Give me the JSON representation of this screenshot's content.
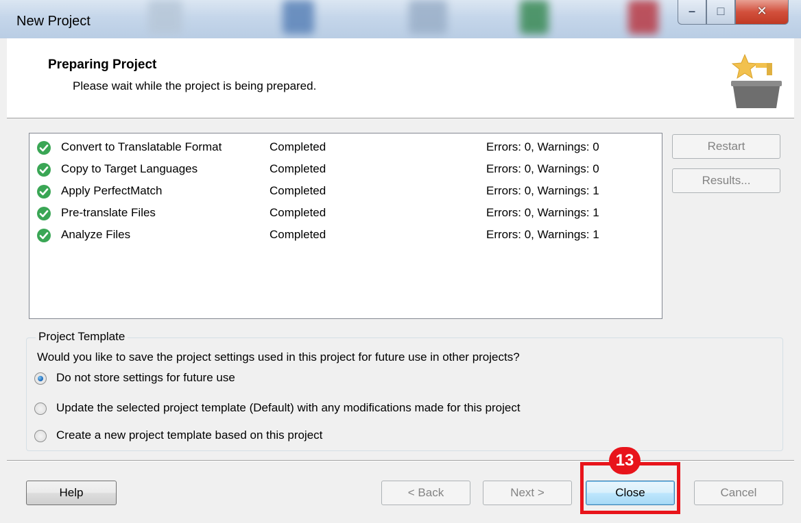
{
  "window": {
    "title": "New Project"
  },
  "header": {
    "title": "Preparing Project",
    "subtitle": "Please wait while the project is being prepared."
  },
  "tasks": [
    {
      "name": "Convert to Translatable Format",
      "status": "Completed",
      "result": "Errors: 0, Warnings: 0"
    },
    {
      "name": "Copy to Target Languages",
      "status": "Completed",
      "result": "Errors: 0, Warnings: 0"
    },
    {
      "name": "Apply PerfectMatch",
      "status": "Completed",
      "result": "Errors: 0, Warnings: 1"
    },
    {
      "name": "Pre-translate Files",
      "status": "Completed",
      "result": "Errors: 0, Warnings: 1"
    },
    {
      "name": "Analyze Files",
      "status": "Completed",
      "result": "Errors: 0, Warnings: 1"
    }
  ],
  "side_buttons": {
    "restart": "Restart",
    "results": "Results..."
  },
  "template_group": {
    "legend": "Project Template",
    "question": "Would you like to save the project settings used in this project for future use in other projects?",
    "options": [
      {
        "label": "Do not store settings for future use",
        "checked": true
      },
      {
        "label": "Update the selected project template (Default) with any modifications made for this project",
        "checked": false
      },
      {
        "label": "Create a new project template based on this project",
        "checked": false
      }
    ]
  },
  "footer": {
    "help": "Help",
    "back": "< Back",
    "next": "Next >",
    "close": "Close",
    "cancel": "Cancel"
  },
  "annotation": {
    "step": "13",
    "color": "#e8141b"
  },
  "colors": {
    "check_green": "#3aa655",
    "accent": "#3c7fb1"
  },
  "icons": {
    "task_status": "check-circle-icon",
    "wizard": "star-basket-icon",
    "caption": [
      "minimize-icon",
      "maximize-icon",
      "close-icon"
    ]
  }
}
